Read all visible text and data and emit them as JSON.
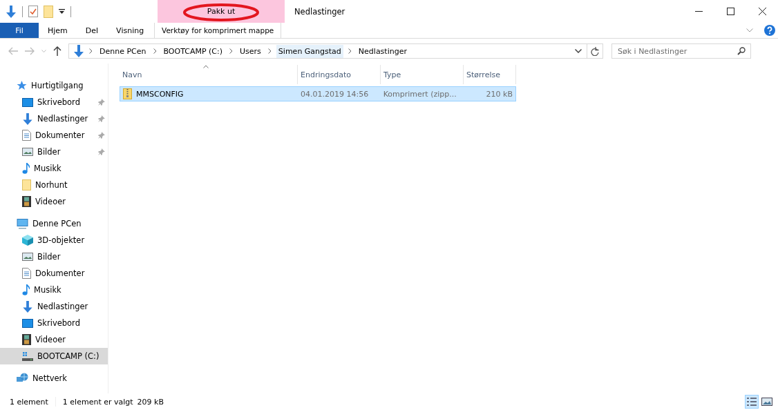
{
  "window": {
    "title": "Nedlastinger"
  },
  "ribbon": {
    "context_header": "Pakk ut",
    "file_button": "Fil",
    "tabs": [
      "Hjem",
      "Del",
      "Visning"
    ],
    "context_tab": "Verktøy for komprimert mappe"
  },
  "address": {
    "segments": [
      {
        "label": "Denne PCen",
        "hovered": false
      },
      {
        "label": "BOOTCAMP (C:)",
        "hovered": false
      },
      {
        "label": "Users",
        "hovered": false
      },
      {
        "label": "Simen Gangstad",
        "hovered": true
      },
      {
        "label": "Nedlastinger",
        "hovered": false
      }
    ]
  },
  "search": {
    "placeholder": "Søk i Nedlastinger"
  },
  "navigation": [
    {
      "label": "Hurtigtilgang",
      "kind": "star",
      "selected": false,
      "children": [
        {
          "label": "Skrivebord",
          "kind": "desktop",
          "pinned": true,
          "selected": false
        },
        {
          "label": "Nedlastinger",
          "kind": "download",
          "pinned": true,
          "selected": false
        },
        {
          "label": "Dokumenter",
          "kind": "document",
          "pinned": true,
          "selected": false
        },
        {
          "label": "Bilder",
          "kind": "pictures",
          "pinned": true,
          "selected": false
        },
        {
          "label": "Musikk",
          "kind": "music",
          "pinned": false,
          "selected": false
        },
        {
          "label": "Norhunt",
          "kind": "folder",
          "pinned": false,
          "selected": false
        },
        {
          "label": "Videoer",
          "kind": "video",
          "pinned": false,
          "selected": false
        }
      ]
    },
    {
      "label": "Denne PCen",
      "kind": "computer",
      "selected": false,
      "children": [
        {
          "label": "3D-objekter",
          "kind": "cube",
          "pinned": false,
          "selected": false
        },
        {
          "label": "Bilder",
          "kind": "pictures",
          "pinned": false,
          "selected": false
        },
        {
          "label": "Dokumenter",
          "kind": "document",
          "pinned": false,
          "selected": false
        },
        {
          "label": "Musikk",
          "kind": "music",
          "pinned": false,
          "selected": false
        },
        {
          "label": "Nedlastinger",
          "kind": "download",
          "pinned": false,
          "selected": false
        },
        {
          "label": "Skrivebord",
          "kind": "desktop",
          "pinned": false,
          "selected": false
        },
        {
          "label": "Videoer",
          "kind": "video",
          "pinned": false,
          "selected": false
        },
        {
          "label": "BOOTCAMP (C:)",
          "kind": "drive",
          "pinned": false,
          "selected": true
        }
      ]
    },
    {
      "label": "Nettverk",
      "kind": "network",
      "selected": false
    }
  ],
  "table": {
    "columns": [
      {
        "label": "Navn",
        "sorted": true
      },
      {
        "label": "Endringsdato",
        "sorted": false
      },
      {
        "label": "Type",
        "sorted": false
      },
      {
        "label": "Størrelse",
        "sorted": false
      }
    ],
    "rows": [
      {
        "name": "MMSCONFIG",
        "date": "04.01.2019 14:56",
        "type": "Komprimert (zipp...",
        "size": "210 kB",
        "selected": true
      }
    ]
  },
  "status_bar": {
    "count": "1 element",
    "selection": "1 element er valgt",
    "selection_size": "209 kB",
    "views": [
      {
        "kind": "details",
        "selected": true
      },
      {
        "kind": "large",
        "selected": false
      }
    ]
  }
}
